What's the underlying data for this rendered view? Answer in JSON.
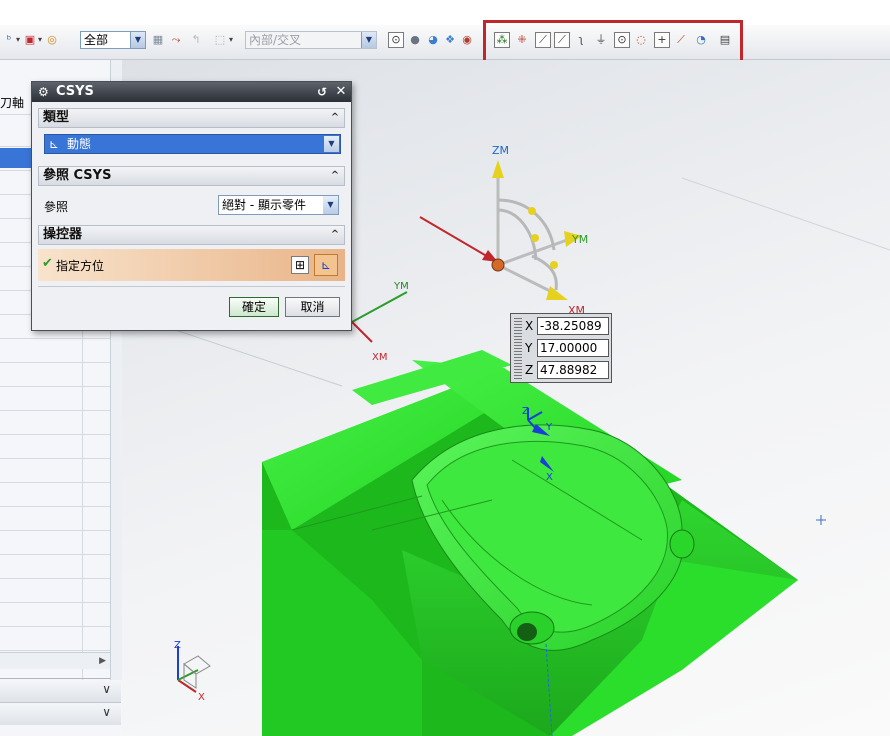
{
  "toolbar": {
    "filter_value": "全部",
    "selection_scope": "內部/交叉"
  },
  "dialog": {
    "title": "CSYS",
    "sections": {
      "type": {
        "label": "類型",
        "value": "動態"
      },
      "reference": {
        "label": "參照 CSYS",
        "field_label": "參照",
        "value": "絕對 - 顯示零件"
      },
      "manipulator": {
        "label": "操控器",
        "field_label": "指定方位"
      }
    },
    "ok_label": "確定",
    "cancel_label": "取消"
  },
  "left_panel": {
    "partial_header": "刀軸"
  },
  "coords": {
    "x_label": "X",
    "x_value": "-38.25089",
    "y_label": "Y",
    "y_value": "17.00000",
    "z_label": "Z",
    "z_value": "47.88982"
  },
  "viewport_labels": {
    "zm": "ZM",
    "ym": "YM",
    "xm": "XM",
    "ym_wcs": "YM",
    "xm_wcs": "XM",
    "part_z": "Z",
    "part_y": "Y",
    "part_x": "X",
    "triad_z": "Z",
    "triad_x": "X"
  },
  "colors": {
    "part_green": "#2ee82e",
    "highlight_red": "#c0272d",
    "axis_yellow": "#e6d21e",
    "axis_blue": "#1a3fd6"
  }
}
